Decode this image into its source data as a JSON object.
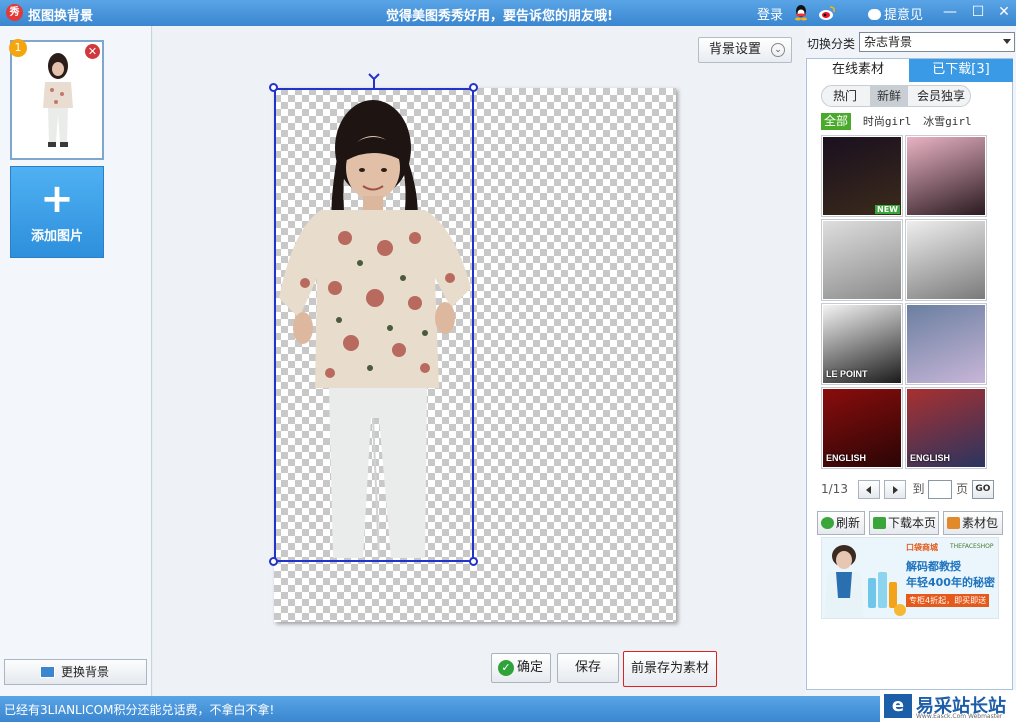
{
  "titlebar": {
    "app_icon": "秀",
    "title": "抠图换背景",
    "slogan": "觉得美图秀秀好用，要告诉您的朋友哦!",
    "login": "登录",
    "feedback": "提意见",
    "minimize": "—",
    "maximize": "☐",
    "close": "✕"
  },
  "left": {
    "thumb_number": "1",
    "add_label": "添加图片",
    "add_symbol": "+",
    "change_bg": "更换背景"
  },
  "canvas": {
    "bg_settings": "背景设置",
    "chevron": "⌄",
    "ok": "确定",
    "save": "保存",
    "save_foreground": "前景存为素材"
  },
  "right": {
    "category_label": "切换分类",
    "category_value": "杂志背景",
    "tab_online": "在线素材",
    "tab_downloaded": "已下载[3]",
    "subtabs": [
      "热门",
      "新鲜",
      "会员独享"
    ],
    "filters": [
      "全部",
      "时尚girl",
      "冰雪girl"
    ],
    "new_badge": "NEW",
    "tiles": [
      {
        "label": "",
        "colors": [
          "#1a1020",
          "#3b2a1a"
        ]
      },
      {
        "label": "",
        "colors": [
          "#e9b3c4",
          "#2a1a20"
        ]
      },
      {
        "label": "",
        "colors": [
          "#dedede",
          "#8a8a8a"
        ]
      },
      {
        "label": "",
        "colors": [
          "#eeeeee",
          "#7a7a7a"
        ]
      },
      {
        "label": "LE POINT",
        "colors": [
          "#f4f4f4",
          "#1a1a1a"
        ]
      },
      {
        "label": "",
        "colors": [
          "#6a7fa0",
          "#c8b6d8"
        ]
      },
      {
        "label": "ENGLISH",
        "colors": [
          "#8a0d0d",
          "#2a0505"
        ]
      },
      {
        "label": "ENGLISH",
        "colors": [
          "#a83030",
          "#2a3560"
        ]
      }
    ],
    "page_info": "1/13",
    "to_label": "到",
    "page_label": "页",
    "go": "GO",
    "refresh": "刷新",
    "download_page": "下载本页",
    "material_pack": "素材包",
    "ad": {
      "brand": "口袋商城",
      "brand2": "THEFACESHOP",
      "headline1": "解码都教授",
      "headline2": "年轻400年的秘密",
      "cta": "专柜4折起，即买即送"
    }
  },
  "status": {
    "tip": "已经有3LIANLICOM积分还能兑话费，不拿白不拿!"
  },
  "watermark": {
    "icon": "e",
    "name": "易采站长站",
    "sub": "Www.Easck.Com Webmaster"
  },
  "colors": {
    "accent": "#3a86d0",
    "selection": "#2233cc",
    "active_filter": "#4aaa2c",
    "tab_active": "#3b9ae6",
    "danger": "#d22222"
  }
}
